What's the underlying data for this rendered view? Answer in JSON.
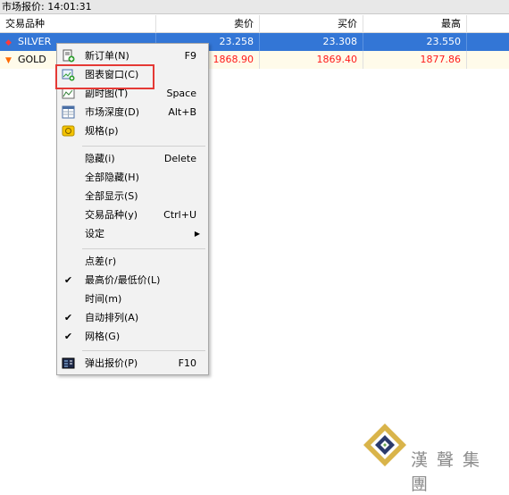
{
  "window": {
    "title": "市场报价: 14:01:31"
  },
  "table": {
    "headers": {
      "symbol": "交易品种",
      "bid": "卖价",
      "ask": "买价",
      "high": "最高"
    },
    "rows": [
      {
        "symbol": "SILVER",
        "bid": "23.258",
        "ask": "23.308",
        "high": "23.550",
        "direction": "up"
      },
      {
        "symbol": "GOLD",
        "bid": "1868.90",
        "ask": "1869.40",
        "high": "1877.86",
        "direction": "down"
      }
    ]
  },
  "context_menu": {
    "items": [
      {
        "label": "新订单(N)",
        "shortcut": "F9",
        "icon": "new-order-icon"
      },
      {
        "label": "图表窗口(C)",
        "shortcut": "",
        "icon": "chart-window-icon"
      },
      {
        "label": "副时图(T)",
        "shortcut": "Space",
        "icon": "tick-chart-icon"
      },
      {
        "label": "市场深度(D)",
        "shortcut": "Alt+B",
        "icon": "market-depth-icon"
      },
      {
        "label": "规格(p)",
        "shortcut": "",
        "icon": "specification-icon"
      },
      {
        "label": "隐藏(i)",
        "shortcut": "Delete"
      },
      {
        "label": "全部隐藏(H)",
        "shortcut": ""
      },
      {
        "label": "全部显示(S)",
        "shortcut": ""
      },
      {
        "label": "交易品种(y)",
        "shortcut": "Ctrl+U"
      },
      {
        "label": "设定",
        "shortcut": "",
        "submenu": true
      },
      {
        "label": "点差(r)",
        "shortcut": ""
      },
      {
        "label": "最高价/最低价(L)",
        "shortcut": "",
        "checked": true
      },
      {
        "label": "时间(m)",
        "shortcut": ""
      },
      {
        "label": "自动排列(A)",
        "shortcut": "",
        "checked": true
      },
      {
        "label": "网格(G)",
        "shortcut": "",
        "checked": true
      },
      {
        "label": "弹出报价(P)",
        "shortcut": "F10",
        "icon": "popup-prices-icon"
      }
    ]
  },
  "watermark": {
    "text": "漢聲集團",
    "icon": "diamond-logo-icon"
  },
  "colors": {
    "selected_row": "#3376d6",
    "price_down": "#ff1a1a",
    "highlight_box": "#e53935"
  }
}
